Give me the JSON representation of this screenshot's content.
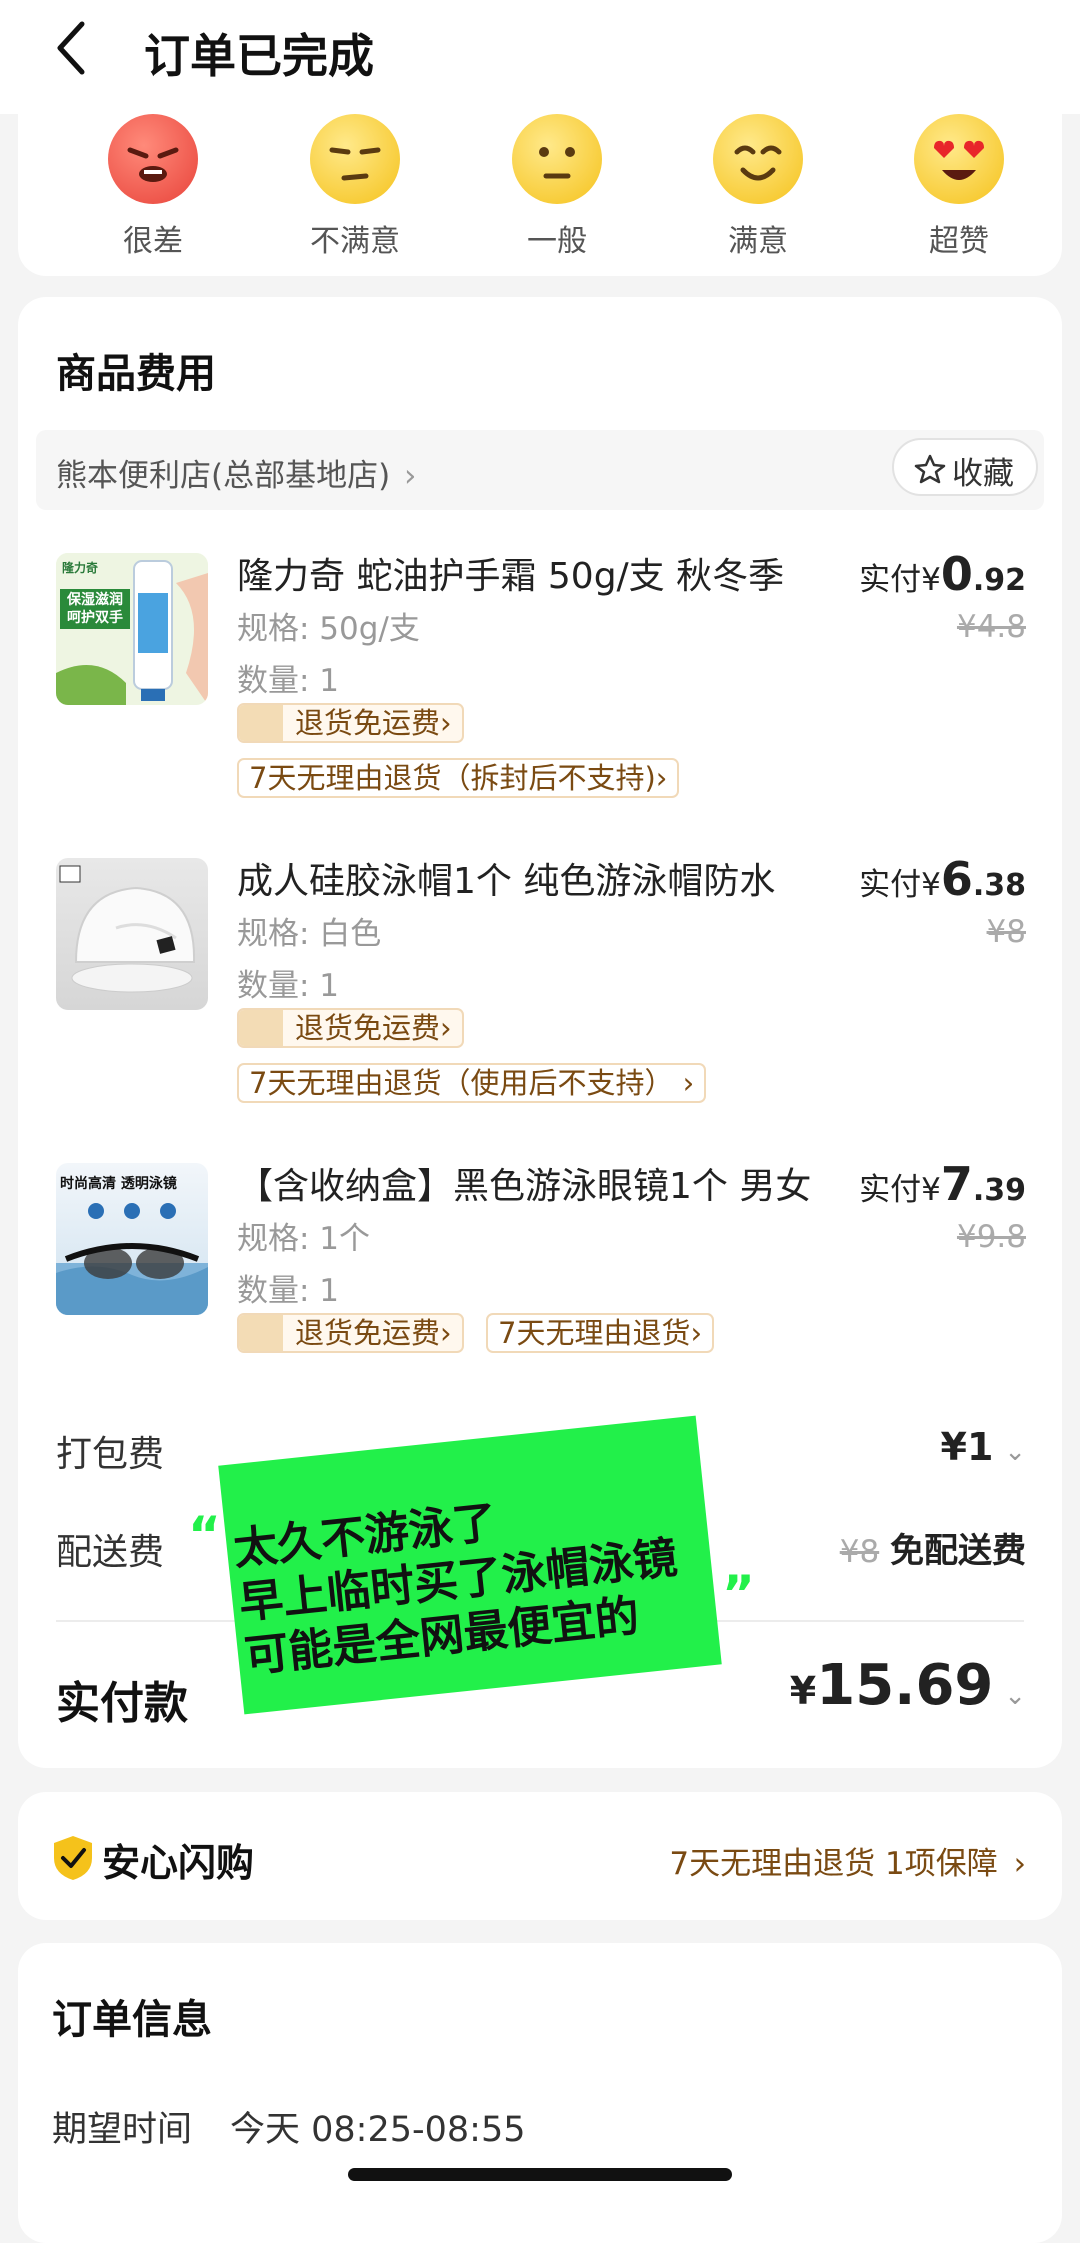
{
  "header": {
    "title": "订单已完成"
  },
  "rating": {
    "items": [
      {
        "label": "很差",
        "icon": "angry-face-icon"
      },
      {
        "label": "不满意",
        "icon": "unamused-face-icon"
      },
      {
        "label": "一般",
        "icon": "neutral-face-icon"
      },
      {
        "label": "满意",
        "icon": "smiling-face-icon"
      },
      {
        "label": "超赞",
        "icon": "heart-eyes-face-icon"
      }
    ]
  },
  "goods": {
    "title": "商品费用",
    "store": {
      "name": "熊本便利店(总部基地店)",
      "arrow": "›",
      "favorite_label": "收藏"
    },
    "products": [
      {
        "name": "隆力奇 蛇油护手霜 50g/支 秋冬季",
        "spec": "规格: 50g/支",
        "qty": "数量: 1",
        "pay_prefix": "实付¥",
        "pay_int": "0",
        "pay_dec": ".92",
        "orig": "¥4.8",
        "tag_ship": "退货免运费›",
        "tag_return": "7天无理由退货（拆封后不支持)›"
      },
      {
        "name": "成人硅胶泳帽1个 纯色游泳帽防水",
        "spec": "规格: 白色",
        "qty": "数量: 1",
        "pay_prefix": "实付¥",
        "pay_int": "6",
        "pay_dec": ".38",
        "orig": "¥8",
        "tag_ship": "退货免运费›",
        "tag_return": "7天无理由退货（使用后不支持） ›"
      },
      {
        "name": "【含收纳盒】黑色游泳眼镜1个 男女",
        "spec": "规格: 1个",
        "qty": "数量: 1",
        "pay_prefix": "实付¥",
        "pay_int": "7",
        "pay_dec": ".39",
        "orig": "¥9.8",
        "tag_ship": "退货免运费›",
        "tag_return": "7天无理由退货›"
      }
    ],
    "product_image_text": {
      "p1_brand": "隆力奇",
      "p1_line1": "保湿滋润",
      "p1_line2": "呵护双手",
      "p3_line1": "时尚高清 透明泳镜"
    },
    "packing_fee": {
      "label": "打包费",
      "value": "¥1"
    },
    "delivery_fee": {
      "label": "配送费",
      "orig": "¥8",
      "value": "免配送费"
    },
    "total": {
      "label": "实付款",
      "currency": "¥",
      "value": "15.69"
    }
  },
  "sticker": {
    "line1": "太久不游泳了",
    "line2": "早上临时买了泳帽泳镜",
    "line3": "可能是全网最便宜的",
    "quote_open": "“",
    "quote_close": "”",
    "color": "#22f04a"
  },
  "guarantee": {
    "title": "安心闪购",
    "detail": "7天无理由退货 1项保障",
    "arrow": "›"
  },
  "order_info": {
    "title": "订单信息",
    "expected_label": "期望时间",
    "expected_value": "今天 08:25-08:55"
  },
  "colors": {
    "accent_brown": "#7a4a12",
    "tag_border": "#f1d9b8",
    "background": "#f4f4f4"
  }
}
